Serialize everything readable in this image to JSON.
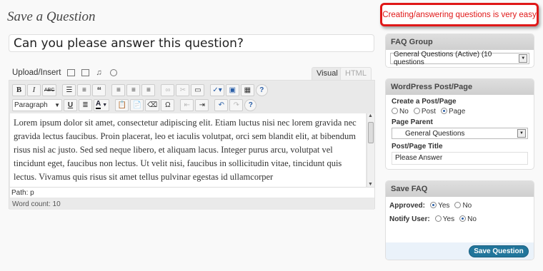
{
  "page_title": "Save a Question",
  "callout": "Creating/answering questions is very easy",
  "title_value": "Can you please answer this question?",
  "upload": {
    "label": "Upload/Insert"
  },
  "tabs": {
    "visual": "Visual",
    "html": "HTML"
  },
  "toolbar": {
    "bold": "B",
    "italic": "I",
    "strike": "ABC",
    "blockquote": "“",
    "format_select": "Paragraph",
    "underline": "U",
    "text_color": "A",
    "special_char": "Ω",
    "help": "?"
  },
  "editor_text": "Lorem ipsum dolor sit amet, consectetur adipiscing elit. Etiam luctus nisi nec lorem gravida nec gravida lectus faucibus. Proin placerat, leo et iaculis volutpat, orci sem blandit elit, at bibendum risus nisl ac justo. Sed sed neque libero, et aliquam lacus. Integer purus arcu, volutpat vel tincidunt eget, faucibus non lectus. Ut velit nisi, faucibus in sollicitudin vitae, tincidunt quis lectus. Vivamus quis risus sit amet tellus pulvinar egestas id ullamcorper",
  "path": "Path: p",
  "word_count": "Word count: 10",
  "faq_group": {
    "heading": "FAQ Group",
    "selected": "General Questions (Active) (10 questions"
  },
  "wp_post": {
    "heading": "WordPress Post/Page",
    "create_label": "Create a Post/Page",
    "options": [
      "No",
      "Post",
      "Page"
    ],
    "parent_label": "Page Parent",
    "parent_selected": "General Questions",
    "title_label": "Post/Page Title",
    "title_value": "Please Answer"
  },
  "save_faq": {
    "heading": "Save FAQ",
    "approved_label": "Approved:",
    "notify_label": "Notify User:",
    "yes": "Yes",
    "no": "No",
    "button": "Save Question"
  }
}
